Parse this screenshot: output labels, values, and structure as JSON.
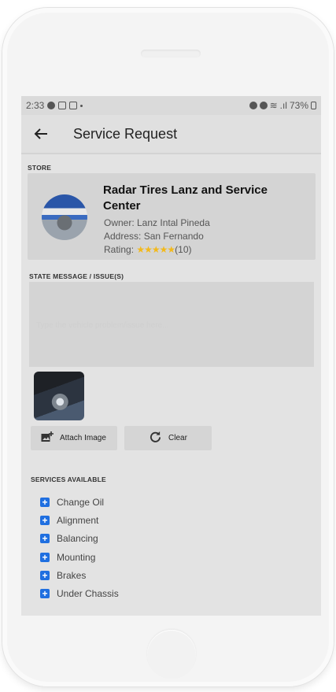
{
  "status_bar": {
    "time": "2:33",
    "battery": "73%"
  },
  "app_bar": {
    "back_icon": "arrow-left-icon",
    "title": "Service Request"
  },
  "store_section": {
    "label": "STORE",
    "name": "Radar Tires Lanz and Service Center",
    "owner": "Owner: Lanz Intal Pineda",
    "address": "Address: San Fernando",
    "rating_prefix": "Rating:",
    "stars": "★★★★★",
    "rating_value": 5,
    "rating_count": "(10)",
    "star_color": "#f3b91b"
  },
  "issue_section": {
    "label": "STATE MESSAGE / ISSUE(S)",
    "value": "",
    "placeholder": "Type the vehicle problem/issue here..."
  },
  "actions": {
    "attach_label": "Attach Image",
    "attach_icon": "add-photo-icon",
    "clear_label": "Clear",
    "clear_icon": "refresh-icon"
  },
  "services": {
    "label": "SERVICES AVAILABLE",
    "plus_color": "#1f6fe0",
    "items": [
      "Change Oil",
      "Alignment",
      "Balancing",
      "Mounting",
      "Brakes",
      "Under Chassis"
    ]
  }
}
